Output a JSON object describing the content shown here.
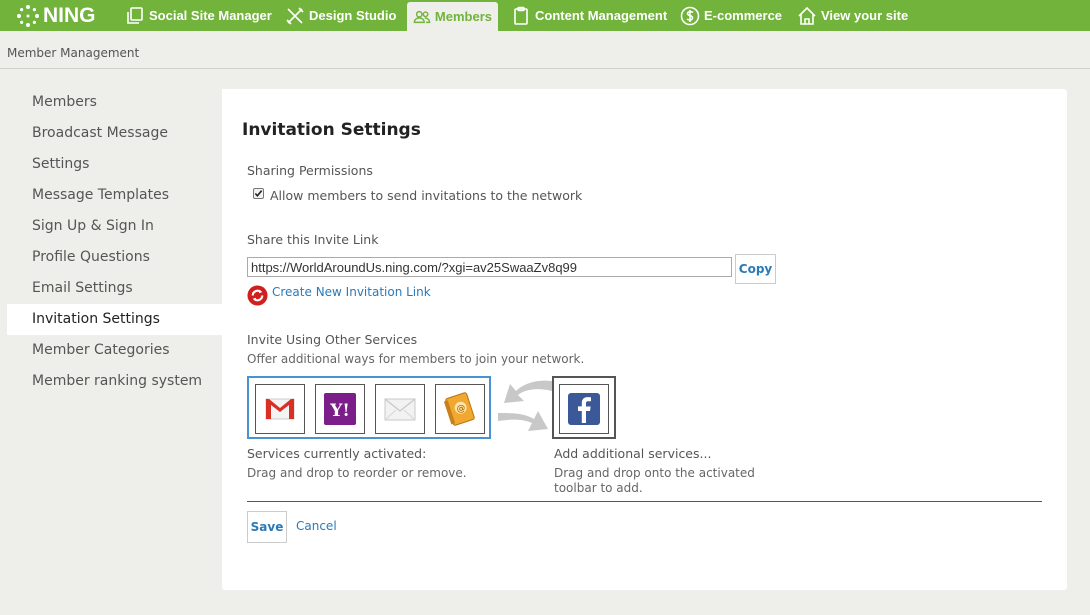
{
  "app": {
    "logo_text": "NING"
  },
  "nav": {
    "tabs": [
      {
        "label": "Social Site Manager"
      },
      {
        "label": "Design Studio"
      },
      {
        "label": "Members"
      },
      {
        "label": "Content Management"
      },
      {
        "label": "E-commerce"
      },
      {
        "label": "View your site"
      }
    ]
  },
  "breadcrumb": "Member Management",
  "sidebar": {
    "items": [
      {
        "label": "Members"
      },
      {
        "label": "Broadcast Message"
      },
      {
        "label": "Settings"
      },
      {
        "label": "Message Templates"
      },
      {
        "label": "Sign Up & Sign In"
      },
      {
        "label": "Profile Questions"
      },
      {
        "label": "Email Settings"
      },
      {
        "label": "Invitation Settings"
      },
      {
        "label": "Member Categories"
      },
      {
        "label": "Member ranking system"
      }
    ]
  },
  "main": {
    "title": "Invitation Settings",
    "sharing": {
      "heading": "Sharing Permissions",
      "checkbox_label": "Allow members to send invitations to the network"
    },
    "invite_link": {
      "heading": "Share this Invite Link",
      "value": "https://WorldAroundUs.ning.com/?xgi=av25SwaaZv8q99",
      "copy_label": "Copy",
      "create_label": "Create New Invitation Link"
    },
    "services": {
      "heading": "Invite Using Other Services",
      "subheading": "Offer additional ways for members to join your network.",
      "activated_title": "Services currently activated:",
      "activated_hint": "Drag and drop to reorder or remove.",
      "add_title": "Add additional services...",
      "add_hint_line1": "Drag and drop onto the activated",
      "add_hint_line2": "toolbar to add."
    },
    "save_label": "Save",
    "cancel_label": "Cancel"
  },
  "colors": {
    "topbar": "#72b33b",
    "link": "#2a7ab8",
    "toolbar_border": "#4a93d3"
  }
}
